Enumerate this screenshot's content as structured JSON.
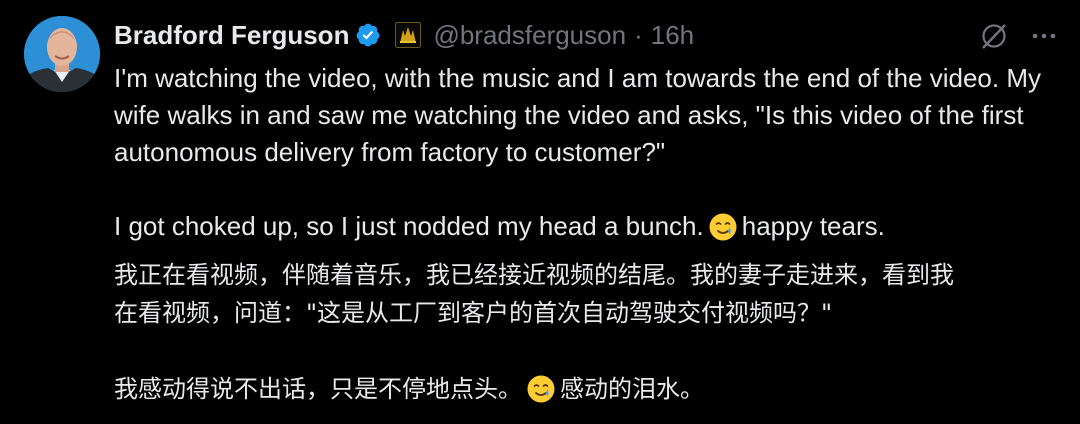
{
  "tweet": {
    "author": {
      "display_name": "Bradford Ferguson",
      "handle": "@bradsferguson",
      "avatar_icon": "user-avatar",
      "verified_icon": "verified-badge-icon",
      "affiliation_icon": "affiliate-logo-icon"
    },
    "separator": "·",
    "time": "16h",
    "actions": {
      "grok_icon": "grok-icon",
      "more_icon": "more-options-icon"
    },
    "paragraphs": {
      "p1": "I'm watching the video, with the music and I am towards the end of the video. My wife walks in and saw me watching the video and asks, \"Is this video of the first autonomous delivery from factory to customer?\"",
      "p2_before": "I got choked up, so I just nodded my head a bunch.",
      "p2_after": "happy tears.",
      "p3": "我正在看视频，伴随着音乐，我已经接近视频的结尾。我的妻子走进来，看到我在看视频，问道：\"这是从工厂到客户的首次自动驾驶交付视频吗？\"",
      "p4_before": "我感动得说不出话，只是不停地点头。",
      "p4_after": "感动的泪水。"
    },
    "emoji_icon": "smiling-face-with-tear-emoji",
    "colors": {
      "background": "#000000",
      "text": "#e7e9ea",
      "secondary_text": "#71767b",
      "verified": "#1d9bf0",
      "affiliate_gold": "#d4a017"
    }
  }
}
